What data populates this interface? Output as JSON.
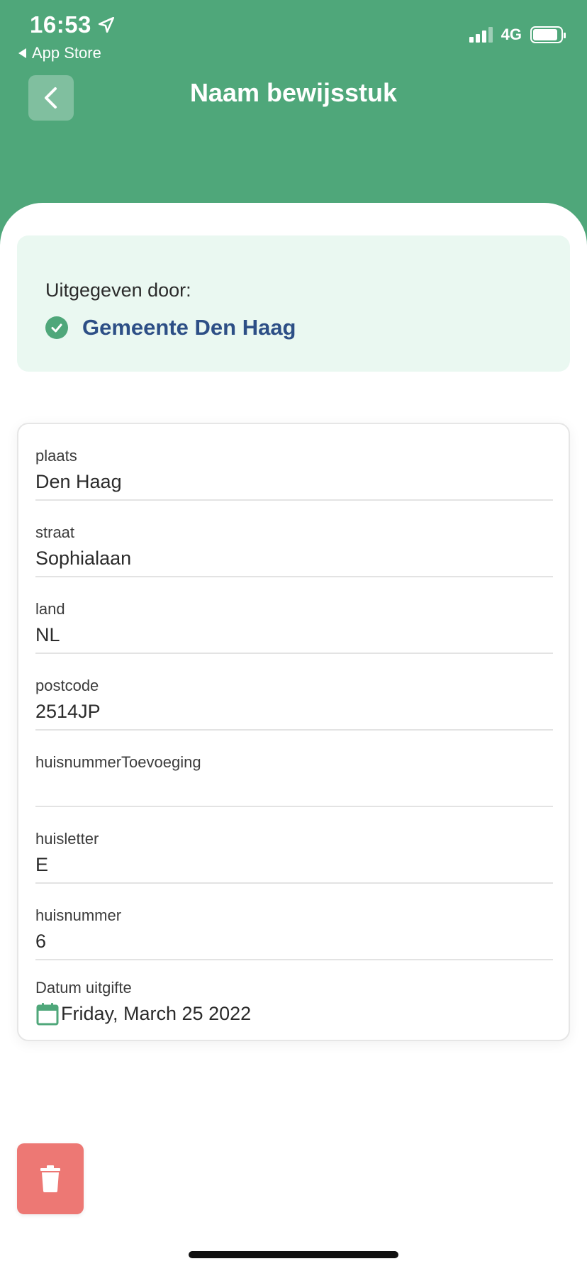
{
  "status_bar": {
    "time": "16:53",
    "back_app": "App Store",
    "network": "4G"
  },
  "nav": {
    "title": "Naam bewijsstuk"
  },
  "issuer": {
    "label": "Uitgegeven door:",
    "name": "Gemeente Den Haag"
  },
  "fields": [
    {
      "label": "plaats",
      "value": "Den Haag"
    },
    {
      "label": "straat",
      "value": "Sophialaan"
    },
    {
      "label": "land",
      "value": "NL"
    },
    {
      "label": "postcode",
      "value": "2514JP"
    },
    {
      "label": "huisnummerToevoeging",
      "value": ""
    },
    {
      "label": "huisletter",
      "value": "E"
    },
    {
      "label": "huisnummer",
      "value": "6"
    }
  ],
  "date": {
    "label": "Datum uitgifte",
    "value": "Friday, March 25 2022",
    "icon": "calendar-icon"
  },
  "actions": {
    "delete_icon": "trash-icon"
  },
  "colors": {
    "primary_green": "#4fa77a",
    "issuer_bg": "#eaf8f1",
    "issuer_name": "#2d4f86",
    "delete_red": "#ed7874"
  }
}
